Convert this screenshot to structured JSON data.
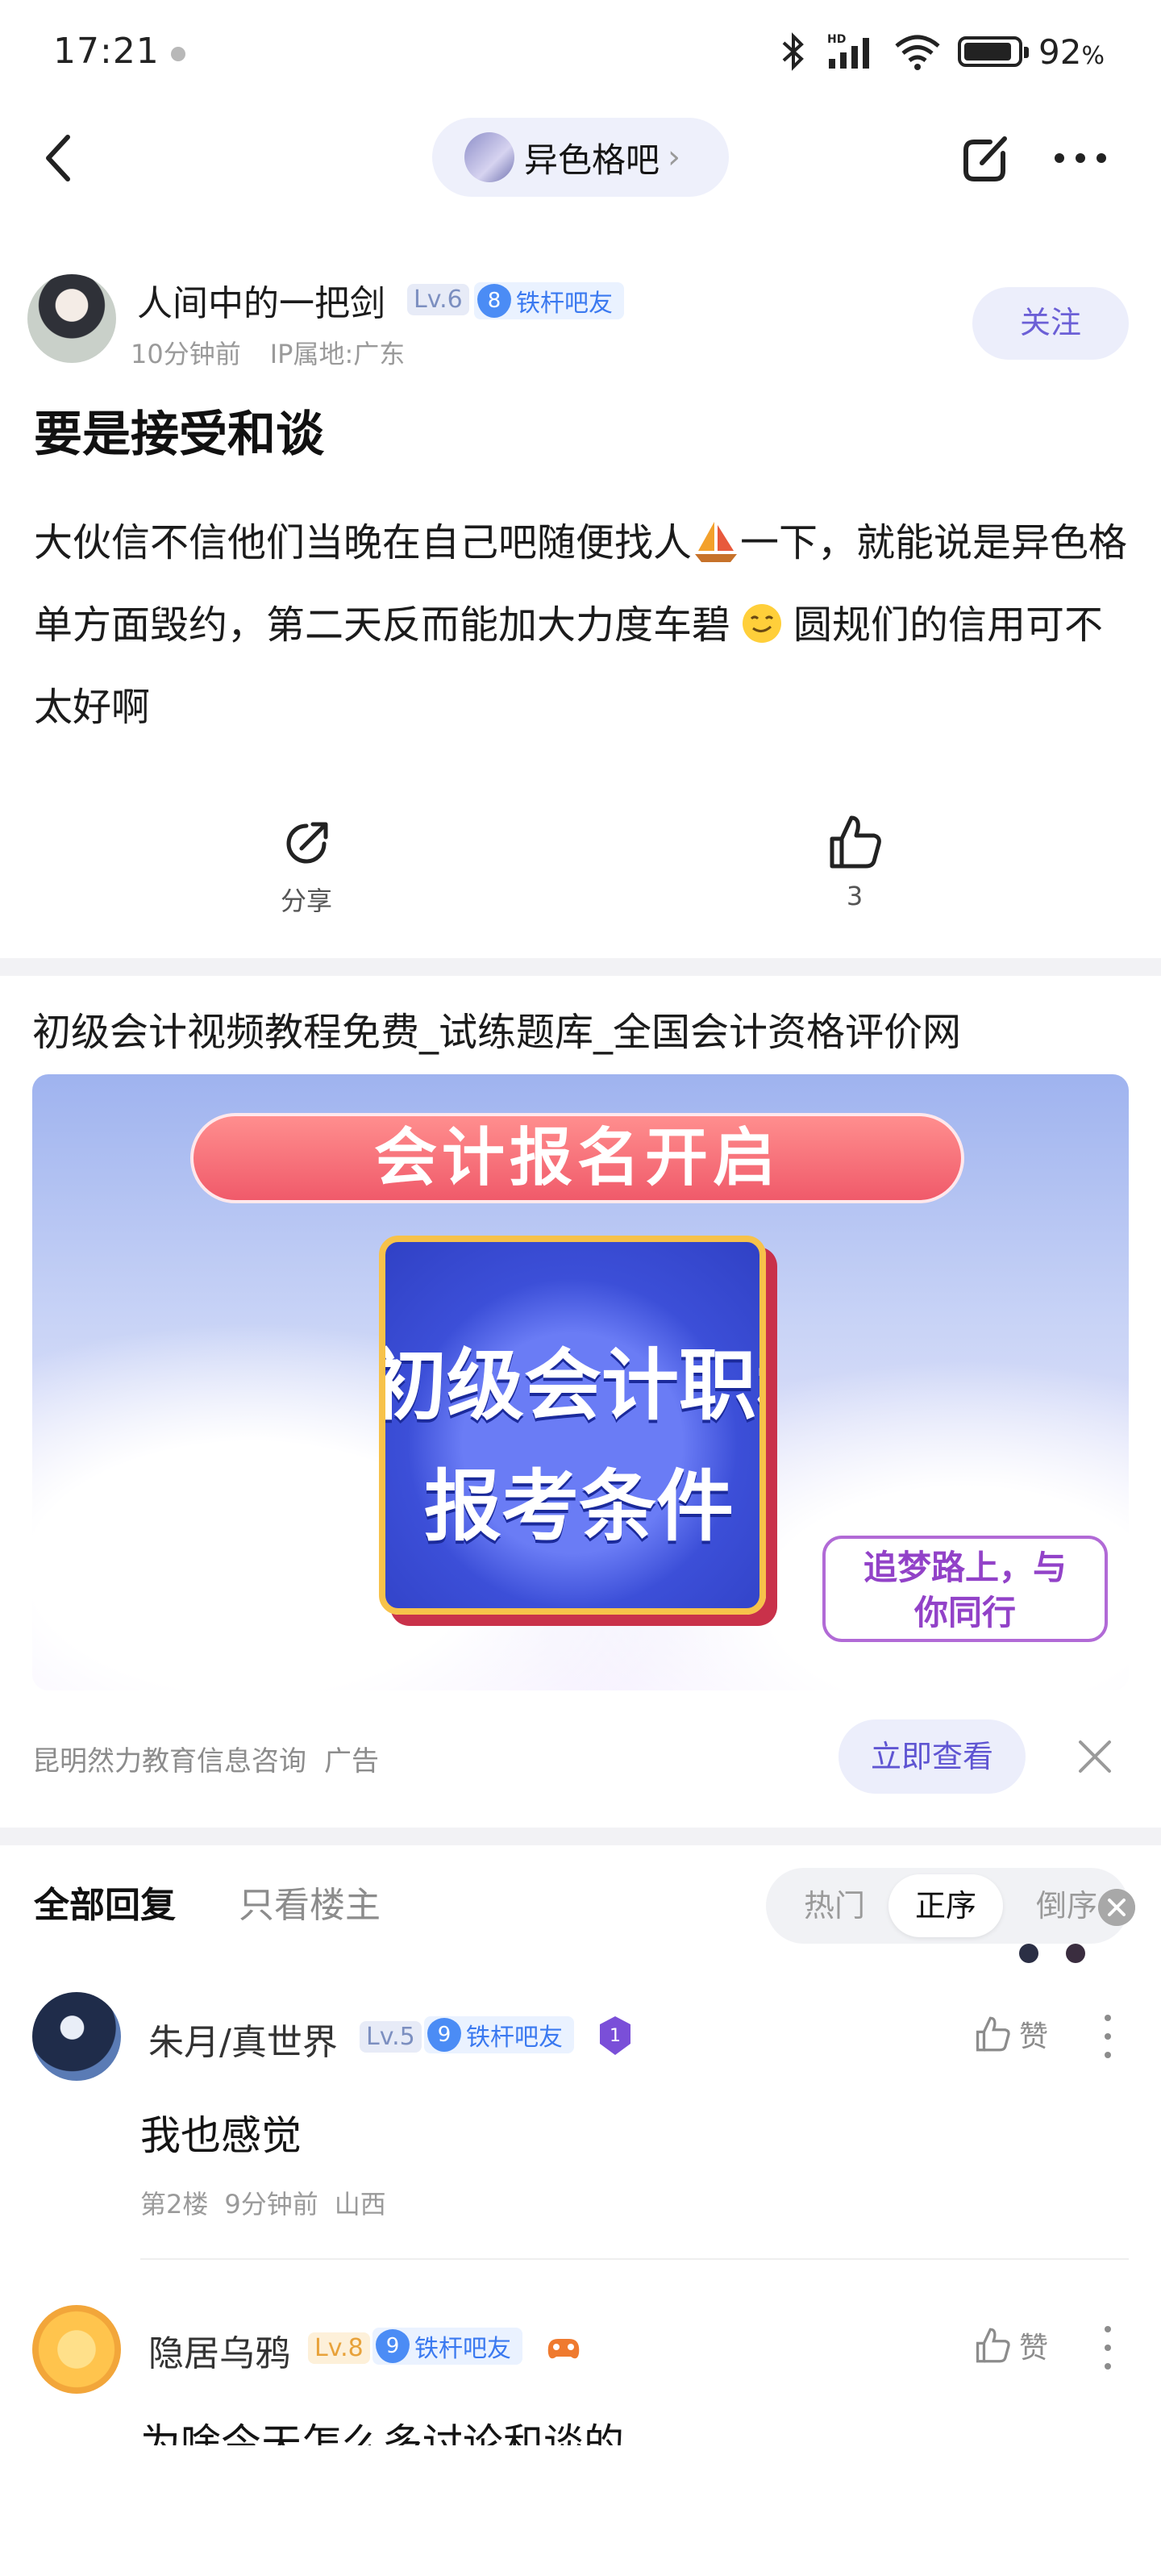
{
  "status_bar": {
    "time": "17:21",
    "battery_percent": "92",
    "battery_unit": "%",
    "icons": [
      "bluetooth-icon",
      "hd-signal-icon",
      "wifi-icon",
      "battery-icon"
    ]
  },
  "nav": {
    "forum_name": "异色格吧",
    "icons": [
      "back-icon",
      "chevron-right-icon",
      "edit-icon",
      "more-icon"
    ]
  },
  "author": {
    "name": "人间中的一把剑",
    "level": "Lv.6",
    "fan_level": "8",
    "fan_title": "铁杆吧友",
    "time_ago": "10分钟前",
    "ip": "IP属地:广东",
    "follow_label": "关注"
  },
  "post": {
    "title": "要是接受和谈",
    "body_part1": "大伙信不信他们当晚在自己吧随便找人",
    "body_part2": "一下，就能说是异色格单方面毁约，第二天反而能加大力度车碧",
    "body_part3": "圆规们的信用可不太好啊",
    "emoji": [
      "sailboat-emoji",
      "smirk-emoji"
    ]
  },
  "actions": {
    "share_label": "分享",
    "like_count": "3"
  },
  "ad": {
    "title": "初级会计视频教程免费_试练题库_全国会计资格评价网",
    "banner": "会计报名开启",
    "card_line1": "初级会计职称",
    "card_line2": "报考条件",
    "slogan_line1": "追梦路上，与",
    "slogan_line2": "你同行",
    "advertiser": "昆明然力教育信息咨询",
    "ad_label": "广告",
    "cta": "立即查看"
  },
  "replies_header": {
    "tab_all": "全部回复",
    "tab_owner": "只看楼主",
    "sort_hot": "热门",
    "sort_asc": "正序",
    "sort_desc": "倒序"
  },
  "replies": [
    {
      "name": "朱月/真世界",
      "level": "Lv.5",
      "fan_level": "9",
      "fan_title": "铁杆吧友",
      "medal": "1",
      "text": "我也感觉",
      "floor": "第2楼",
      "time_ago": "9分钟前",
      "location": "山西",
      "like_label": "赞"
    },
    {
      "name": "隐居乌鸦",
      "level": "Lv.8",
      "fan_level": "9",
      "fan_title": "铁杆吧友",
      "text": "为啥今天怎么多讨论和谈的",
      "like_label": "赞"
    }
  ],
  "colors": {
    "accent": "#6b5fd6",
    "fan_badge": "#3a79f0",
    "level_badge_gold": "#e8a23a"
  }
}
